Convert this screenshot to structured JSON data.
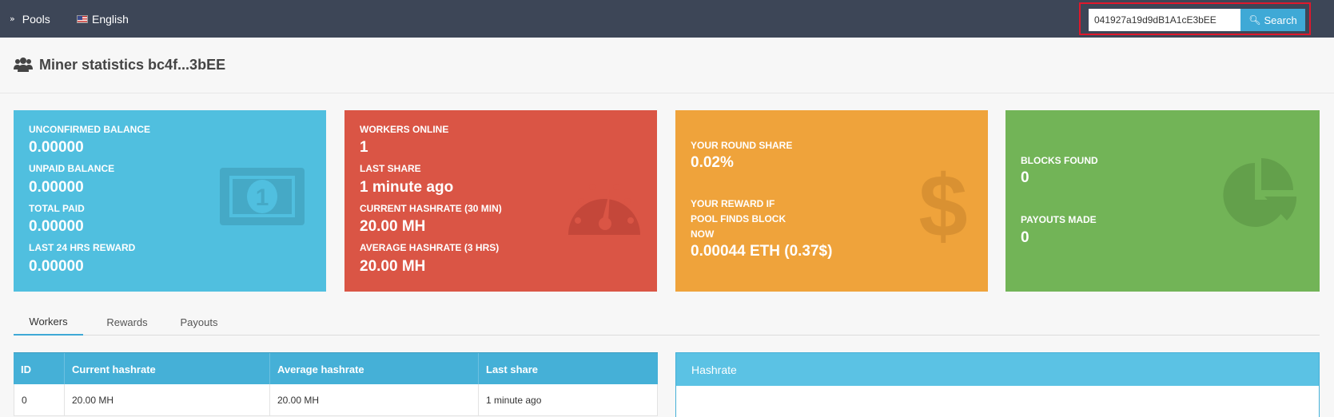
{
  "nav": {
    "pools_label": "Pools",
    "language_label": "English",
    "search_value": "041927a19d9dB1A1cE3bEE",
    "search_button": "Search"
  },
  "page": {
    "title": "Miner statistics bc4f...3bEE"
  },
  "cards": {
    "balance": {
      "unconfirmed_label": "UNCONFIRMED BALANCE",
      "unconfirmed_value": "0.00000",
      "unpaid_label": "UNPAID BALANCE",
      "unpaid_value": "0.00000",
      "total_paid_label": "TOTAL PAID",
      "total_paid_value": "0.00000",
      "last24_label": "LAST 24 HRS REWARD",
      "last24_value": "0.00000",
      "icon": "banknote-icon"
    },
    "workers": {
      "online_label": "WORKERS ONLINE",
      "online_value": "1",
      "last_share_label": "LAST SHARE",
      "last_share_value": "1 minute ago",
      "current_label": "CURRENT HASHRATE (30 min)",
      "current_value": "20.00 MH",
      "average_label": "AVERAGE HASHRATE (3 hrs)",
      "average_value": "20.00 MH",
      "icon": "speedometer-icon"
    },
    "share": {
      "round_share_label": "YOUR ROUND SHARE",
      "round_share_value": "0.02%",
      "reward_label_1": "YOUR REWARD IF",
      "reward_label_2": "POOL FINDS BLOCK",
      "reward_label_3": "NOW",
      "reward_value": "0.00044 ETH (0.37$)",
      "icon": "dollar-icon"
    },
    "blocks": {
      "blocks_label": "BLOCKS FOUND",
      "blocks_value": "0",
      "payouts_label": "PAYOUTS MADE",
      "payouts_value": "0",
      "icon": "pie-chart-icon"
    }
  },
  "tabs": [
    "Workers",
    "Rewards",
    "Payouts"
  ],
  "workers_table": {
    "headers": [
      "ID",
      "Current hashrate",
      "Average hashrate",
      "Last share"
    ],
    "rows": [
      [
        "0",
        "20.00 MH",
        "20.00 MH",
        "1 minute ago"
      ]
    ]
  },
  "hashrate_panel": {
    "title": "Hashrate"
  },
  "colors": {
    "nav_bg": "#3d4657",
    "blue": "#50bfdf",
    "red": "#da5545",
    "orange": "#efa33b",
    "green": "#72b457",
    "accent": "#3fa9d6",
    "highlight": "#e0182c"
  }
}
